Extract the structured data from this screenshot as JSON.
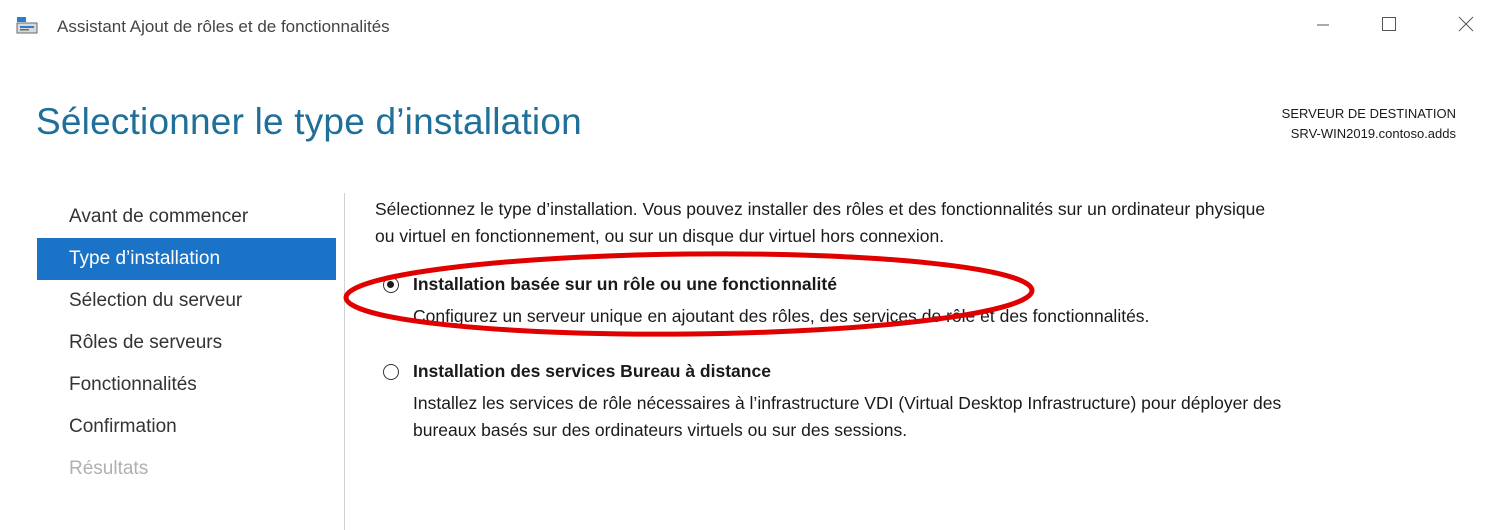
{
  "window": {
    "title": "Assistant Ajout de rôles et de fonctionnalités",
    "icon": "server-manager-icon",
    "controls": {
      "minimize": "minimize-icon",
      "maximize": "maximize-icon",
      "close": "close-icon"
    }
  },
  "header": {
    "page_title": "Sélectionner le type d’installation",
    "destination_label": "SERVEUR DE DESTINATION",
    "destination_server": "SRV-WIN2019.contoso.adds"
  },
  "nav": {
    "items": [
      {
        "label": "Avant de commencer",
        "state": "normal"
      },
      {
        "label": "Type d’installation",
        "state": "active"
      },
      {
        "label": "Sélection du serveur",
        "state": "normal"
      },
      {
        "label": "Rôles de serveurs",
        "state": "normal"
      },
      {
        "label": "Fonctionnalités",
        "state": "normal"
      },
      {
        "label": "Confirmation",
        "state": "normal"
      },
      {
        "label": "Résultats",
        "state": "disabled"
      }
    ]
  },
  "main": {
    "intro_line1": "Sélectionnez le type d’installation. Vous pouvez installer des rôles et des fonctionnalités sur un ordinateur physique",
    "intro_line2": "ou virtuel en fonctionnement, ou sur un disque dur virtuel hors connexion.",
    "options": [
      {
        "label": "Installation basée sur un rôle ou une fonctionnalité",
        "description_line1": "Configurez un serveur unique en ajoutant des rôles, des services de rôle et des fonctionnalités.",
        "checked": true
      },
      {
        "label": "Installation des services Bureau à distance",
        "description_line1": "Installez les services de rôle nécessaires à l’infrastructure VDI (Virtual Desktop Infrastructure) pour déployer des",
        "description_line2": "bureaux basés sur des ordinateurs virtuels ou sur des sessions.",
        "checked": false
      }
    ]
  },
  "colors": {
    "accent": "#1a73c7",
    "title": "#1e6f9a",
    "annotation": "#e00000",
    "disabled_text": "#b0b0b0"
  }
}
